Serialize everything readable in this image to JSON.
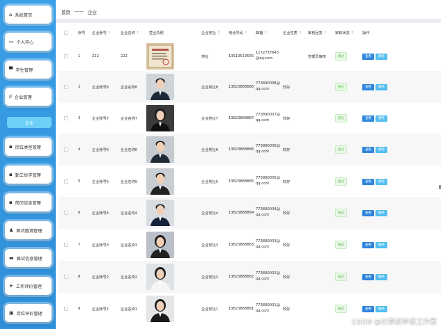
{
  "sidebar": {
    "items": [
      {
        "label": "系统首页",
        "icon": "home-icon",
        "glyph": "⌂"
      },
      {
        "label": "个人中心",
        "icon": "user-card-icon",
        "glyph": "▭"
      },
      {
        "label": "学生管理",
        "icon": "monitor-icon",
        "glyph": "▀"
      },
      {
        "label": "企业管理",
        "icon": "bar-chart-icon",
        "glyph": "ıl"
      },
      {
        "label": "岗位类型管理",
        "icon": "grid-icon",
        "glyph": "▪"
      },
      {
        "label": "勤工俭学管理",
        "icon": "grid-icon",
        "glyph": "▪"
      },
      {
        "label": "简历信息管理",
        "icon": "grid-icon",
        "glyph": "▪"
      },
      {
        "label": "面试邀请管理",
        "icon": "person-icon",
        "glyph": "♟"
      },
      {
        "label": "面试信息管理",
        "icon": "briefcase-icon",
        "glyph": "▬"
      },
      {
        "label": "工作评价管理",
        "icon": "send-icon",
        "glyph": "➤"
      },
      {
        "label": "岗位评价管理",
        "icon": "box-icon",
        "glyph": "▣"
      }
    ],
    "sub_item": "企业"
  },
  "breadcrumb": {
    "home": "首页",
    "sep": "——",
    "current": "企业"
  },
  "table": {
    "headers": [
      "序号",
      "企业账号",
      "企业名称",
      "营业执照",
      "企业地址",
      "电话号码",
      "邮箱",
      "企业性质",
      "审核回复",
      "审核状态",
      "操作"
    ],
    "rows": [
      {
        "no": "1",
        "account": "222",
        "name": "222",
        "address": "地址",
        "phone": "13513513555",
        "email1": "1172737643",
        "email2": "@qq.com",
        "nature": "",
        "reply": "管理员审核",
        "status": "通过",
        "photo": "license"
      },
      {
        "no": "2",
        "account": "企业账号8",
        "name": "企业名称8",
        "address": "企业地址8",
        "phone": "13823888888",
        "email1": "773890008@",
        "email2": "qq.com",
        "nature": "较好",
        "reply": "",
        "status": "通过",
        "photo": "man-glasses"
      },
      {
        "no": "3",
        "account": "企业账号7",
        "name": "企业名称7",
        "address": "企业地址7",
        "phone": "13823888887",
        "email1": "773890007@",
        "email2": "qq.com",
        "nature": "较好",
        "reply": "",
        "status": "通过",
        "photo": "woman-dark"
      },
      {
        "no": "4",
        "account": "企业账号6",
        "name": "企业名称6",
        "address": "企业地址6",
        "phone": "13823888886",
        "email1": "773890006@",
        "email2": "qq.com",
        "nature": "较好",
        "reply": "",
        "status": "通过",
        "photo": "man-suit"
      },
      {
        "no": "5",
        "account": "企业账号5",
        "name": "企业名称5",
        "address": "企业地址5",
        "phone": "13823888885",
        "email1": "773890005@",
        "email2": "qq.com",
        "nature": "较好",
        "reply": "",
        "status": "通过",
        "photo": "man-suit2"
      },
      {
        "no": "6",
        "account": "企业账号4",
        "name": "企业名称4",
        "address": "企业地址4",
        "phone": "13823888884",
        "email1": "773890004@",
        "email2": "qq.com",
        "nature": "较好",
        "reply": "",
        "status": "通过",
        "photo": "man-full"
      },
      {
        "no": "7",
        "account": "企业账号3",
        "name": "企业名称3",
        "address": "企业地址3",
        "phone": "13823888883",
        "email1": "773890003@",
        "email2": "qq.com",
        "nature": "较好",
        "reply": "",
        "status": "通过",
        "photo": "woman-office"
      },
      {
        "no": "8",
        "account": "企业账号2",
        "name": "企业名称2",
        "address": "企业地址2",
        "phone": "13823888882",
        "email1": "773890002@",
        "email2": "qq.com",
        "nature": "较好",
        "reply": "",
        "status": "通过",
        "photo": "woman-white"
      },
      {
        "no": "9",
        "account": "企业账号1",
        "name": "企业名称1",
        "address": "企业地址1",
        "phone": "13823888881",
        "email1": "773890001@",
        "email2": "qq.com",
        "nature": "较好",
        "reply": "",
        "status": "通过",
        "photo": "woman-suit"
      }
    ],
    "view_label": "查看",
    "delete_label": "删除"
  },
  "watermark": "CSDN @计算机毕设工作室",
  "colors": {
    "sidebar": "#3aa0e8",
    "view_button": "#2f86dd",
    "delete_button": "#52bdf1",
    "status_bg": "#e8f8e6",
    "status_text": "#5fbf50"
  }
}
